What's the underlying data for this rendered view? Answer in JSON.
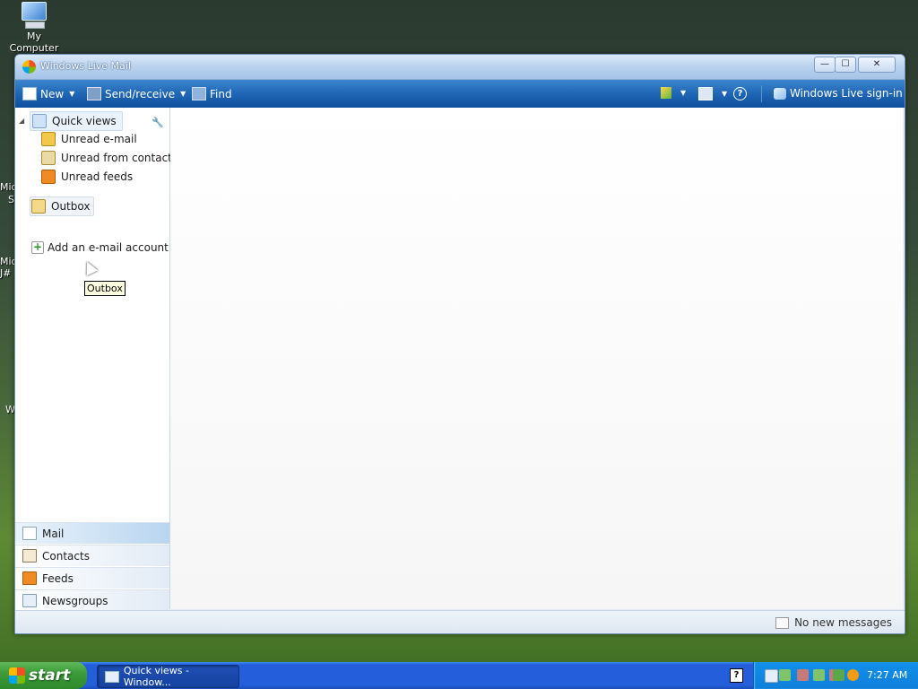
{
  "desktop": {
    "icons": [
      {
        "label": "My Computer",
        "icon": "my-computer-icon"
      }
    ],
    "edge_labels": [
      "Mic",
      "S",
      "Mic",
      "J#",
      "W"
    ]
  },
  "window": {
    "title": "Windows Live Mail",
    "controls": {
      "minimize": "—",
      "maximize": "☐",
      "close": "✕"
    }
  },
  "toolbar": {
    "new_label": "New",
    "send_receive_label": "Send/receive",
    "find_label": "Find",
    "signin_label": "Windows Live sign-in",
    "help_glyph": "?"
  },
  "nav": {
    "quick_views_label": "Quick views",
    "quick_views_items": [
      {
        "label": "Unread e-mail",
        "icon": "unread-email-icon"
      },
      {
        "label": "Unread from contacts",
        "icon": "unread-contacts-icon"
      },
      {
        "label": "Unread feeds",
        "icon": "unread-feeds-icon"
      }
    ],
    "outbox_label": "Outbox",
    "add_account_label": "Add an e-mail account",
    "tooltip": "Outbox"
  },
  "nav_buttons": [
    {
      "label": "Mail",
      "icon": "mail-icon",
      "active": true
    },
    {
      "label": "Contacts",
      "icon": "contacts-icon",
      "active": false
    },
    {
      "label": "Feeds",
      "icon": "feeds-icon",
      "active": false
    },
    {
      "label": "Newsgroups",
      "icon": "newsgroups-icon",
      "active": false
    }
  ],
  "status": {
    "text": "No new messages"
  },
  "taskbar": {
    "start_label": "start",
    "task_label": "Quick views - Window...",
    "help_tray": "?",
    "clock": "7:27 AM"
  },
  "colors": {
    "toolbar": "#1f66b5",
    "start": "#3c9c3a",
    "taskbar": "#245edb",
    "tray": "#0f7fdb"
  }
}
